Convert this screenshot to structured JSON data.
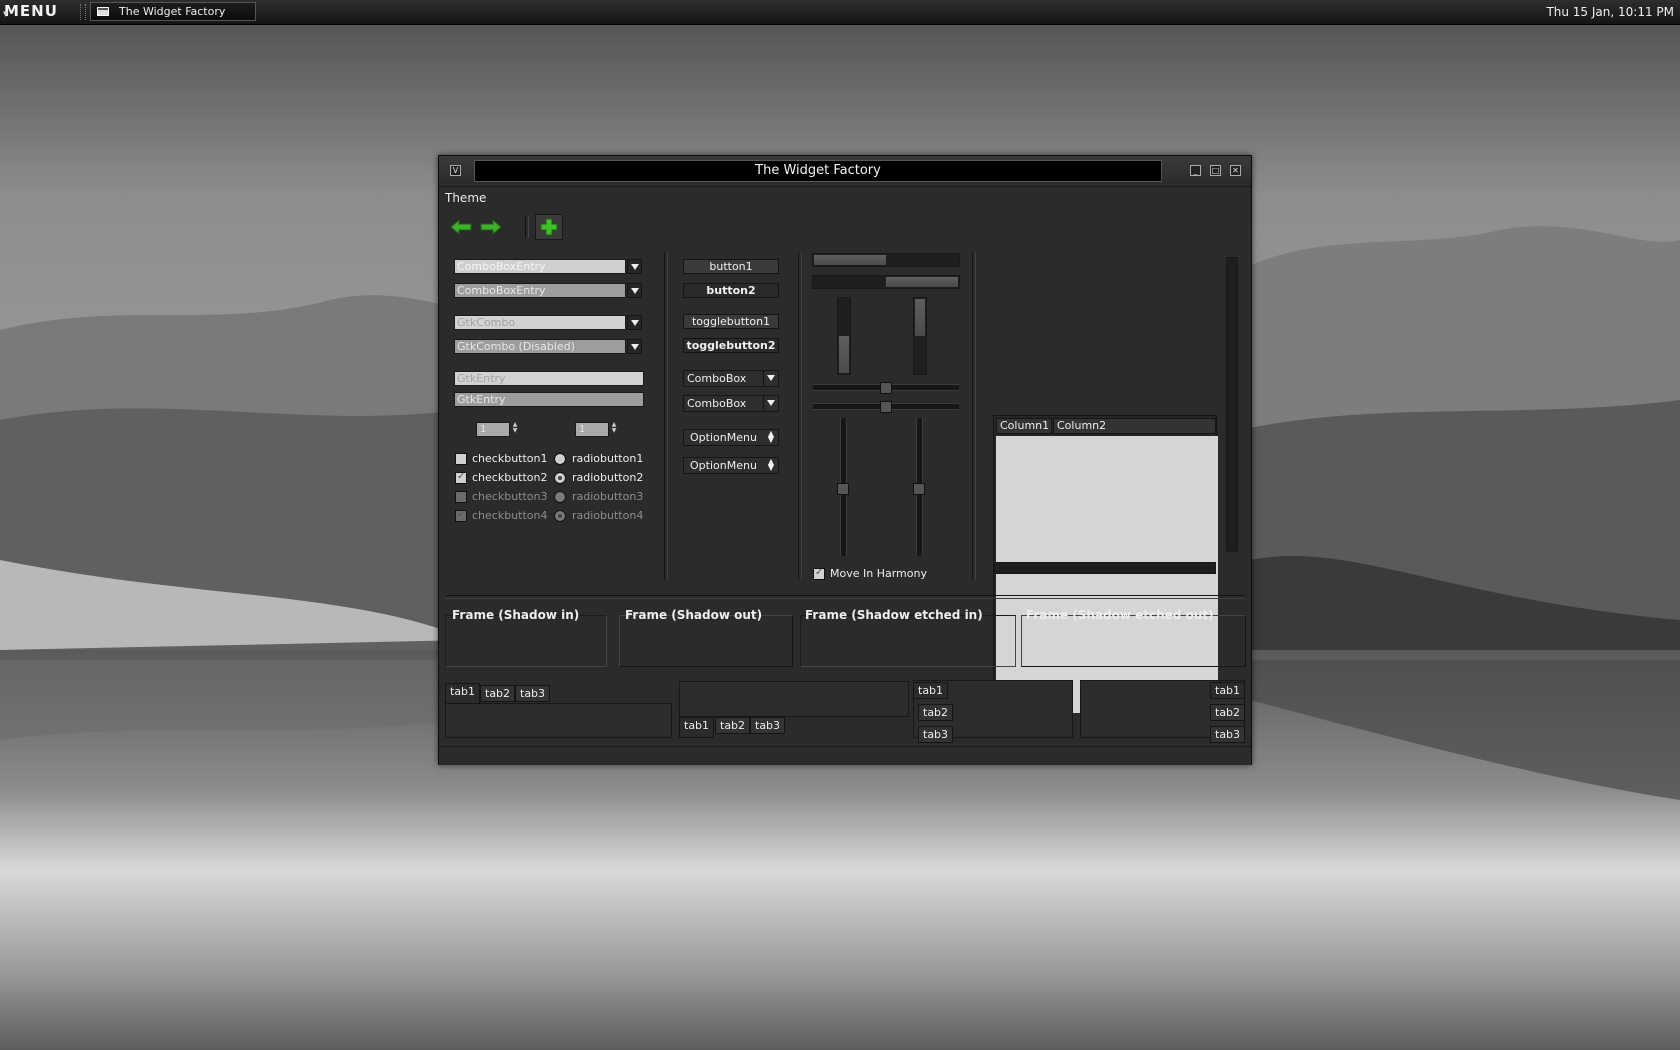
{
  "panel": {
    "menu_label": "MENU",
    "task_title": "The Widget Factory",
    "clock": "Thu 15 Jan, 10:11 PM"
  },
  "window": {
    "title": "The Widget Factory",
    "menu": [
      "Theme"
    ],
    "toolbar": {
      "back_icon": "arrow-left-icon",
      "forward_icon": "arrow-right-icon",
      "add_icon": "plus-icon"
    }
  },
  "left": {
    "combo_entries": [
      "ComboBoxEntry",
      "ComboBoxEntry"
    ],
    "gtk_combos": [
      "GtkCombo",
      "GtkCombo (Disabled)"
    ],
    "entries": [
      "GtkEntry",
      "GtkEntry"
    ],
    "spin_values": [
      "1",
      "1"
    ],
    "checks": [
      {
        "label": "checkbutton1",
        "checked": false,
        "disabled": false
      },
      {
        "label": "checkbutton2",
        "checked": true,
        "disabled": false
      },
      {
        "label": "checkbutton3",
        "checked": false,
        "disabled": true
      },
      {
        "label": "checkbutton4",
        "checked": true,
        "disabled": true
      }
    ],
    "radios": [
      {
        "label": "radiobutton1",
        "checked": false,
        "disabled": false
      },
      {
        "label": "radiobutton2",
        "checked": true,
        "disabled": false
      },
      {
        "label": "radiobutton3",
        "checked": false,
        "disabled": true
      },
      {
        "label": "radiobutton4",
        "checked": true,
        "disabled": true
      }
    ]
  },
  "middle": {
    "buttons": [
      "button1",
      "button2"
    ],
    "toggles": [
      "togglebutton1",
      "togglebutton2"
    ],
    "comboboxes": [
      "ComboBox",
      "ComboBox"
    ],
    "optionmenus": [
      "OptionMenu",
      "OptionMenu"
    ]
  },
  "ranges": {
    "progress_h": [
      0.5,
      0.5
    ],
    "progress_v": [
      0.5,
      0.5
    ],
    "move_in_harmony_label": "Move In Harmony",
    "move_in_harmony_checked": true
  },
  "tree": {
    "columns": [
      "Column1",
      "Column2"
    ]
  },
  "frames": [
    "Frame (Shadow in)",
    "Frame (Shadow out)",
    "Frame (Shadow etched in)",
    "Frame (Shadow etched out)"
  ],
  "notebooks": {
    "tabs": [
      "tab1",
      "tab2",
      "tab3"
    ]
  }
}
